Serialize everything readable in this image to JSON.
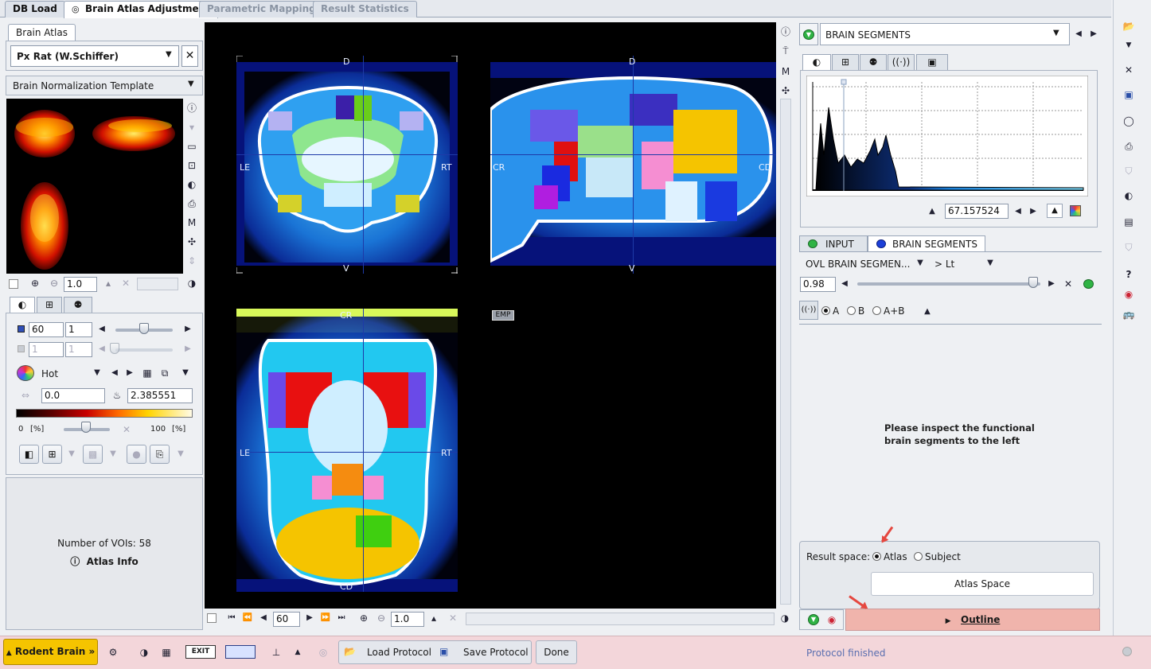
{
  "tabs": [
    "DB Load",
    "Brain Atlas Adjustment",
    "Parametric Mapping",
    "Result Statistics"
  ],
  "left": {
    "subtab": "Brain Atlas",
    "atlas_select": "Px Rat (W.Schiffer)",
    "template_select": "Brain Normalization Template",
    "zoom_value": "1.0",
    "ctrl": {
      "slice_value": "60",
      "slice_step": "1",
      "slice_value2": "1",
      "slice_step2": "1",
      "colormap": "Hot",
      "min_value": "0.0",
      "max_value": "2.385551",
      "range_min_label": "0",
      "range_max_label": "100",
      "range_unit": "[%]"
    },
    "info": {
      "voi_count": "Number of VOIs: 58",
      "atlas_info": "Atlas Info"
    }
  },
  "center": {
    "labels": {
      "D": "D",
      "V": "V",
      "LE": "LE",
      "RT": "RT",
      "CR": "CR",
      "CD": "CD",
      "EMP": "EMP"
    },
    "slice_value": "60",
    "zoom_value": "1.0"
  },
  "right": {
    "segment_select": "BRAIN SEGMENTS",
    "hist_value": "67.157524",
    "input_tab": "INPUT",
    "segments_tab": "BRAIN SEGMENTS",
    "ovl_select": "OVL  BRAIN SEGMEN...",
    "lt_select": "> Lt",
    "opacity": "0.98",
    "opt_a": "A",
    "opt_b": "B",
    "opt_ab": "A+B",
    "message": "Please inspect the functional brain segments to the left",
    "result_space_label": "Result space:",
    "atlas_opt": "Atlas",
    "subject_opt": "Subject",
    "atlas_space_btn": "Atlas Space",
    "outline_btn": "Outline"
  },
  "bottom": {
    "rodent_btn": "Rodent Brain »",
    "load_protocol": "Load Protocol",
    "save_protocol": "Save Protocol",
    "done": "Done",
    "status": "Protocol finished"
  },
  "colors": {
    "accent_yellow": "#f5c400",
    "outline_red": "#f2b6b0",
    "status_bar": "#f3d6da"
  }
}
